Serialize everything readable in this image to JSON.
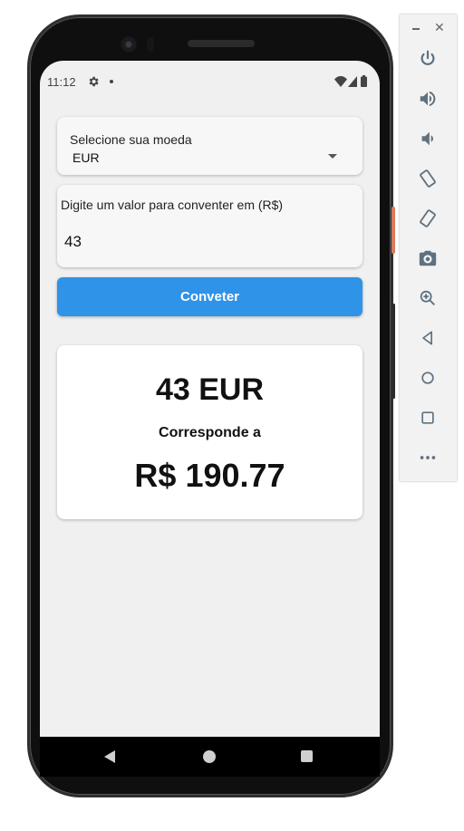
{
  "status_bar": {
    "time": "11:12"
  },
  "currency_select": {
    "label": "Selecione sua moeda",
    "selected": "EUR"
  },
  "amount_input": {
    "label": "Digite um valor para conventer em (R$)",
    "value": "43"
  },
  "convert_button": {
    "label": "Conveter"
  },
  "result": {
    "amount": "43 EUR",
    "caption": "Corresponde a",
    "converted": "R$ 190.77"
  },
  "colors": {
    "accent": "#2f93e8",
    "screen_bg": "#f0f0f0",
    "card_bg": "#f7f7f7",
    "power_button": "#d97a5c"
  },
  "toolbar_icons": [
    "power-icon",
    "volume-up-icon",
    "volume-down-icon",
    "rotate-left-icon",
    "rotate-right-icon",
    "camera-icon",
    "zoom-icon",
    "back-icon",
    "home-icon",
    "overview-icon",
    "more-icon"
  ]
}
